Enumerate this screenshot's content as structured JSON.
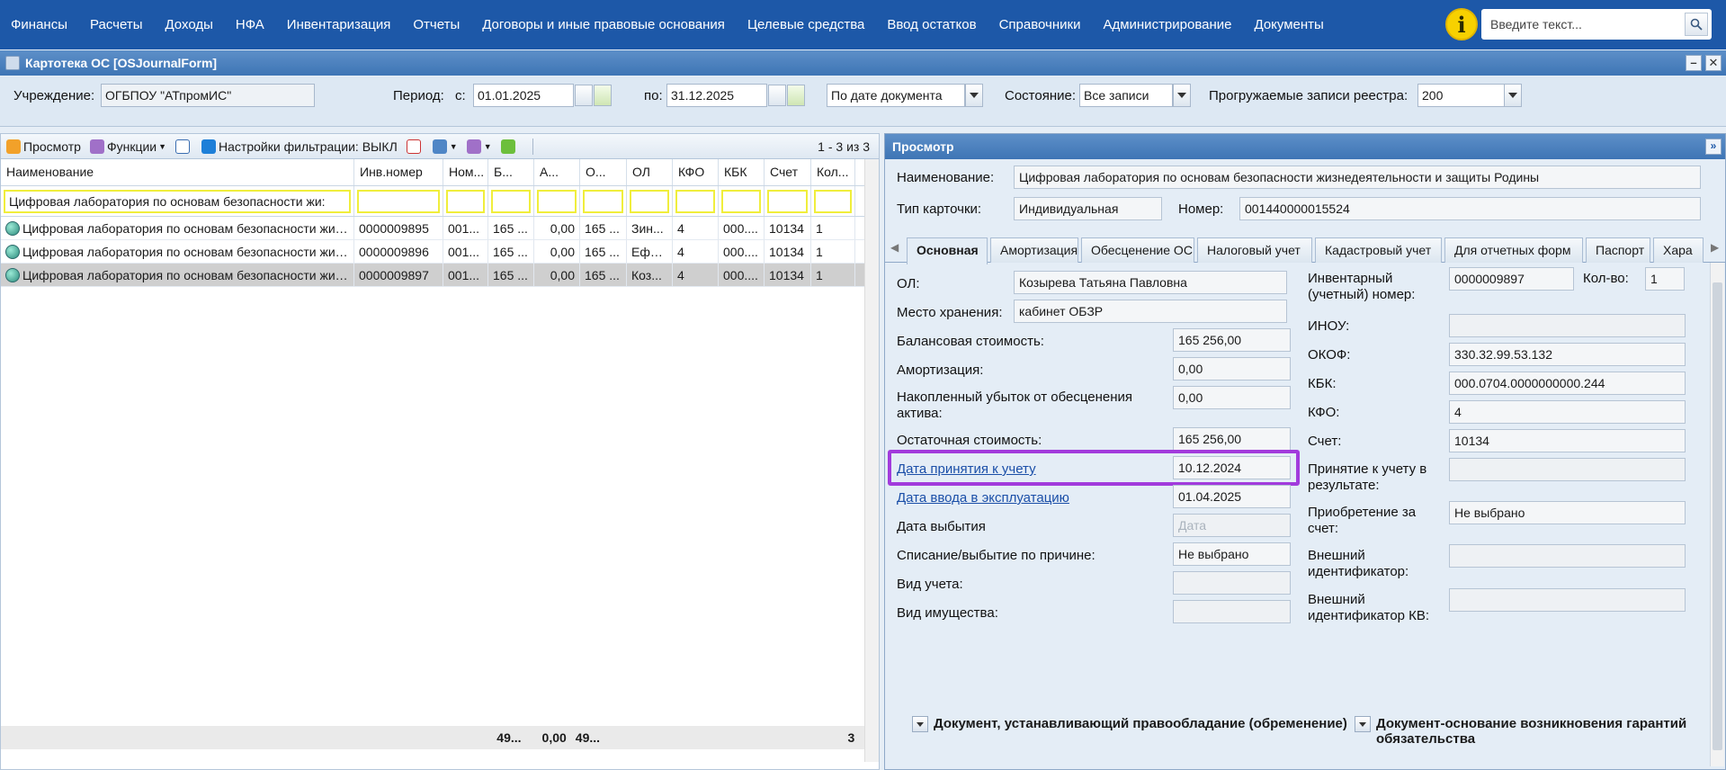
{
  "nav": [
    "Финансы",
    "Расчеты",
    "Доходы",
    "НФА",
    "Инвентаризация",
    "Отчеты",
    "Договоры и иные правовые основания",
    "Целевые средства",
    "Ввод остатков",
    "Справочники",
    "Администрирование",
    "Документы"
  ],
  "search": {
    "placeholder": "Введите текст..."
  },
  "window": {
    "title": "Картотека ОС [OSJournalForm]"
  },
  "filter": {
    "institution_label": "Учреждение:",
    "institution_value": "ОГБПОУ \"АТпромИС\"",
    "period_label": "Период:",
    "from_label": "с:",
    "from_value": "01.01.2025",
    "to_label": "по:",
    "to_value": "31.12.2025",
    "date_mode": "По дате документа",
    "state_label": "Состояние:",
    "state_value": "Все записи",
    "records_label": "Прогружаемые записи реестра:",
    "records_value": "200"
  },
  "toolbar": {
    "view": "Просмотр",
    "functions": "Функции",
    "filter_settings": "Настройки фильтрации: ВЫКЛ",
    "count": "1 - 3 из 3"
  },
  "grid": {
    "columns": [
      "Наименование",
      "Инв.номер",
      "Ном...",
      "Б...",
      "А...",
      "О...",
      "ОЛ",
      "КФО",
      "КБК",
      "Счет",
      "Кол..."
    ],
    "filter_name": "Цифровая лаборатория по основам безопасности жи:",
    "rows": [
      [
        "Цифровая лаборатория по основам безопасности жиз...",
        "0000009895",
        "001...",
        "165 ...",
        "0,00",
        "165 ...",
        "Зин...",
        "4",
        "000....",
        "10134",
        "1"
      ],
      [
        "Цифровая лаборатория по основам безопасности жиз...",
        "0000009896",
        "001...",
        "165 ...",
        "0,00",
        "165 ...",
        "Ефр...",
        "4",
        "000....",
        "10134",
        "1"
      ],
      [
        "Цифровая лаборатория по основам безопасности жиз...",
        "0000009897",
        "001...",
        "165 ...",
        "0,00",
        "165 ...",
        "Коз...",
        "4",
        "000....",
        "10134",
        "1"
      ]
    ],
    "totals": {
      "b": "49...",
      "a": "0,00",
      "o": "49...",
      "count": "3"
    }
  },
  "view_panel": {
    "title": "Просмотр",
    "name_label": "Наименование:",
    "name_value": "Цифровая лаборатория по основам безопасности жизнедеятельности и защиты Родины",
    "card_type_label": "Тип карточки:",
    "card_type_value": "Индивидуальная",
    "number_label": "Номер:",
    "number_value": "001440000015524",
    "tabs": [
      "Основная",
      "Амортизация",
      "Обесценение ОС",
      "Налоговый учет",
      "Кадастровый учет",
      "Для отчетных форм",
      "Паспорт",
      "Хара"
    ],
    "left_fields": {
      "ol_label": "ОЛ:",
      "ol_value": "Козырева Татьяна Павловна",
      "storage_label": "Место хранения:",
      "storage_value": "кабинет ОБЗР",
      "balance_label": "Балансовая стоимость:",
      "balance_value": "165 256,00",
      "amort_label": "Амортизация:",
      "amort_value": "0,00",
      "loss_label": "Накопленный убыток от обесценения актива:",
      "loss_value": "0,00",
      "residual_label": "Остаточная стоимость:",
      "residual_value": "165 256,00",
      "accept_date_label": "Дата принятия к учету",
      "accept_date_value": "10.12.2024",
      "commission_date_label": "Дата ввода в эксплуатацию",
      "commission_date_value": "01.04.2025",
      "disposal_date_label": "Дата выбытия",
      "disposal_date_placeholder": "Дата",
      "writeoff_label": "Списание/выбытие по причине:",
      "writeoff_value": "Не выбрано",
      "acc_type_label": "Вид учета:",
      "property_type_label": "Вид имущества:"
    },
    "right_fields": {
      "inv_label": "Инвентарный (учетный) номер:",
      "inv_value": "0000009897",
      "qty_label": "Кол-во:",
      "qty_value": "1",
      "inou_label": "ИНОУ:",
      "okof_label": "ОКОФ:",
      "okof_value": "330.32.99.53.132",
      "kbk_label": "КБК:",
      "kbk_value": "000.0704.0000000000.244",
      "kfo_label": "КФО:",
      "kfo_value": "4",
      "account_label": "Счет:",
      "account_value": "10134",
      "accept_result_label": "Принятие к учету в результате:",
      "purchase_label": "Приобретение за счет:",
      "purchase_value": "Не выбрано",
      "ext_id_label": "Внешний идентификатор:",
      "ext_id_kv_label": "Внешний идентификатор КВ:"
    },
    "sections": {
      "ownership_doc": "Документ, устанавливающий правообладание (обременение)",
      "guarantee_doc": "Документ-основание возникновения гарантий обязательства"
    }
  }
}
